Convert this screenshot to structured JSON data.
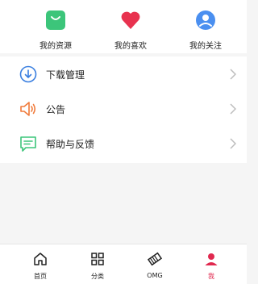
{
  "quick_links": [
    {
      "label": "我的资源",
      "icon": "bag-icon",
      "color": "#3cc57a"
    },
    {
      "label": "我的喜欢",
      "icon": "heart-icon",
      "color": "#e8324f"
    },
    {
      "label": "我的关注",
      "icon": "user-icon",
      "color": "#4a8ff0"
    }
  ],
  "menu": [
    {
      "label": "下载管理",
      "icon": "download-icon",
      "color": "#3a7fe0"
    },
    {
      "label": "公告",
      "icon": "speaker-icon",
      "color": "#f07a3a"
    },
    {
      "label": "帮助与反馈",
      "icon": "feedback-icon",
      "color": "#3cc57a"
    }
  ],
  "tabbar": [
    {
      "label": "首页",
      "icon": "home-icon"
    },
    {
      "label": "分类",
      "icon": "grid-icon"
    },
    {
      "label": "OMG",
      "icon": "ticket-icon"
    },
    {
      "label": "我",
      "icon": "person-icon",
      "active": true
    }
  ],
  "colors": {
    "active_tab": "#e0294f",
    "chevron": "#bdbdbd"
  }
}
